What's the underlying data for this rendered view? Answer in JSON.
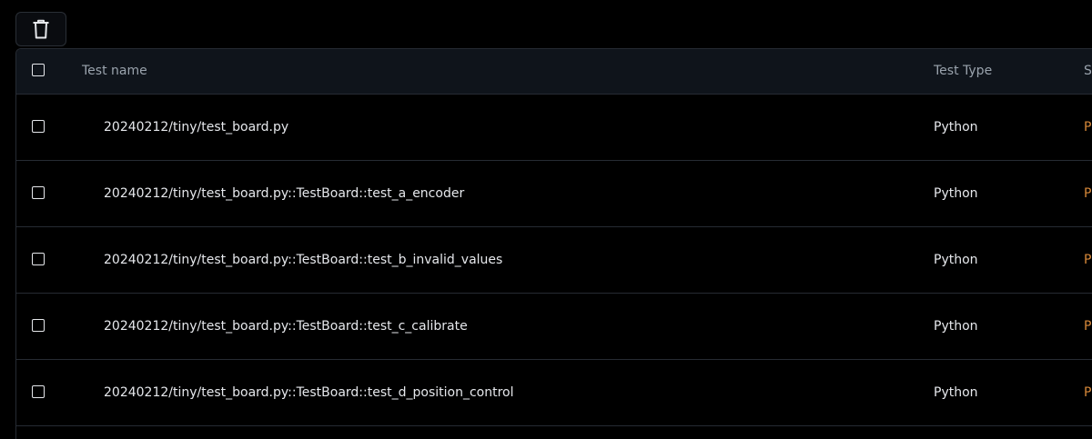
{
  "toolbar": {
    "delete_icon": "trash-icon"
  },
  "table": {
    "columns": [
      {
        "label": "Test name"
      },
      {
        "label": "Test Type"
      },
      {
        "label": "St"
      }
    ],
    "rows": [
      {
        "name": "20240212/tiny/test_board.py",
        "type": "Python",
        "status": "P"
      },
      {
        "name": "20240212/tiny/test_board.py::TestBoard::test_a_encoder",
        "type": "Python",
        "status": "P"
      },
      {
        "name": "20240212/tiny/test_board.py::TestBoard::test_b_invalid_values",
        "type": "Python",
        "status": "P"
      },
      {
        "name": "20240212/tiny/test_board.py::TestBoard::test_c_calibrate",
        "type": "Python",
        "status": "P"
      },
      {
        "name": "20240212/tiny/test_board.py::TestBoard::test_d_position_control",
        "type": "Python",
        "status": "P"
      }
    ]
  },
  "colors": {
    "background": "#000000",
    "header_bg": "#0f141b",
    "border": "#262b33",
    "text": "#e6e8ec",
    "header_text": "#9aa3ad",
    "status": "#d8893a"
  }
}
